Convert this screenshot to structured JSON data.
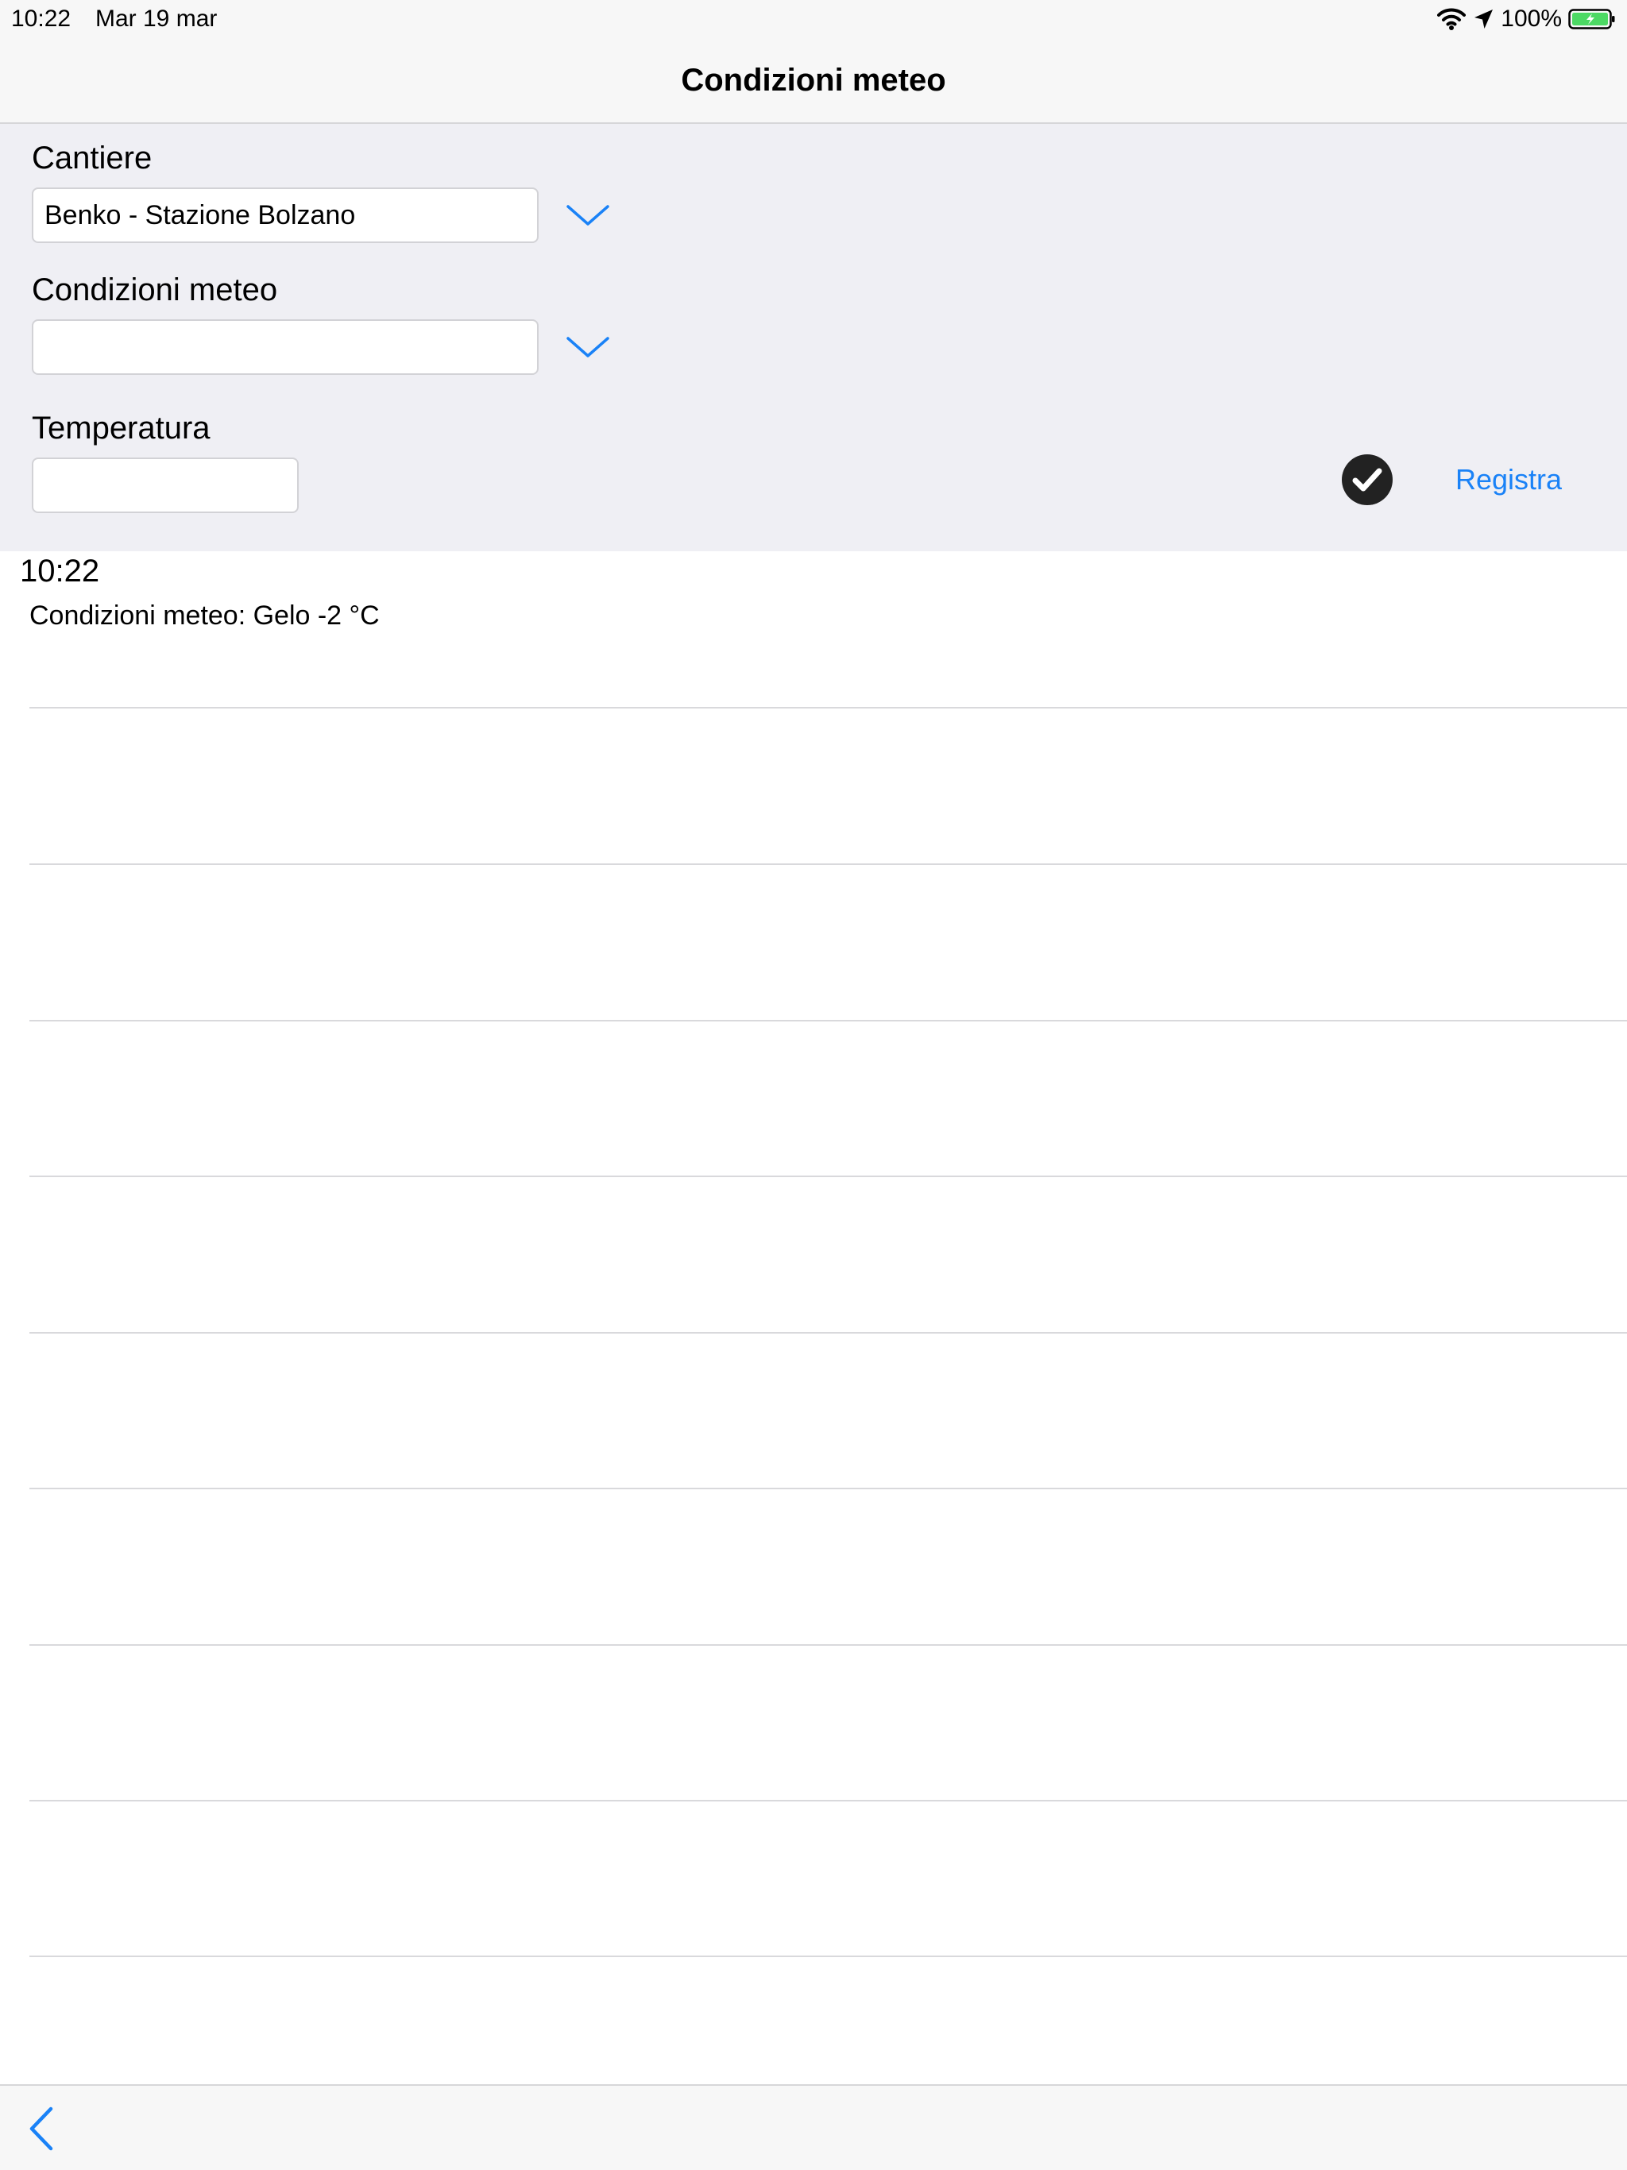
{
  "status_bar": {
    "time": "10:22",
    "date": "Mar 19 mar",
    "battery_percent": "100%",
    "battery_color": "#4cd964",
    "icons": [
      "wifi-icon",
      "location-arrow-icon",
      "battery-icon"
    ]
  },
  "nav": {
    "title": "Condizioni meteo"
  },
  "form": {
    "cantiere": {
      "label": "Cantiere",
      "value": "Benko - Stazione Bolzano"
    },
    "condizioni": {
      "label": "Condizioni meteo",
      "value": ""
    },
    "temperatura": {
      "label": "Temperatura",
      "value": ""
    },
    "registra_label": "Registra",
    "accent_color": "#1a82f7",
    "panel_background": "#efeff4"
  },
  "entries": [
    {
      "time": "10:22",
      "text": "Condizioni meteo: Gelo -2 °C"
    }
  ],
  "toolbar": {
    "back_icon": "chevron-left-icon"
  }
}
